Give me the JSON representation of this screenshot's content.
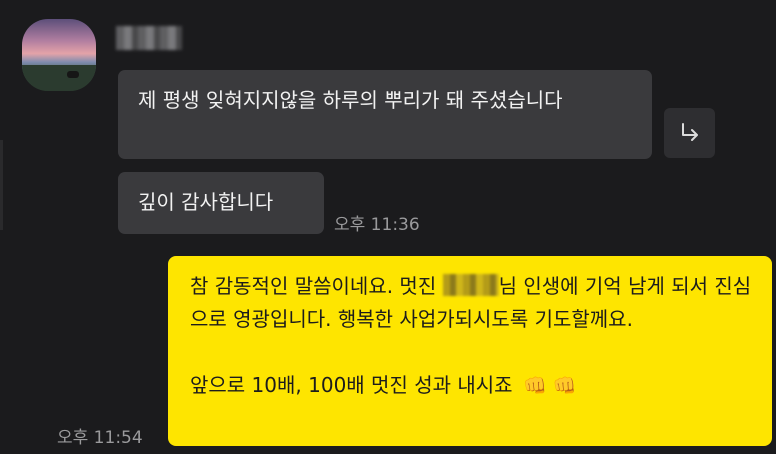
{
  "chat": {
    "sender": {
      "name": ""
    },
    "incoming": {
      "message1": "제 평생 잊혀지지않을 하루의 뿌리가 돼 주셨습니다",
      "message2": "깊이 감사합니다",
      "time": "오후 11:36"
    },
    "outgoing": {
      "line1_before_name": "참 감동적인 말씀이네요. 멋진 ",
      "redacted_name": "",
      "line1_after_name": "님 인생에 기억 남게 되서 진심으로 영광입니다. 행복한 사업가되시도록 기도할께요.",
      "line2": "앞으로 10배, 100배 멋진 성과 내시죠",
      "emoji": "👊 👊",
      "time": "오후 11:54"
    }
  },
  "colors": {
    "background": "#1b1b1d",
    "incoming_bubble": "#3a3a3d",
    "outgoing_bubble": "#fee500",
    "timestamp": "#9a9a9c"
  },
  "icons": {
    "reply": "reply-arrow-icon"
  }
}
